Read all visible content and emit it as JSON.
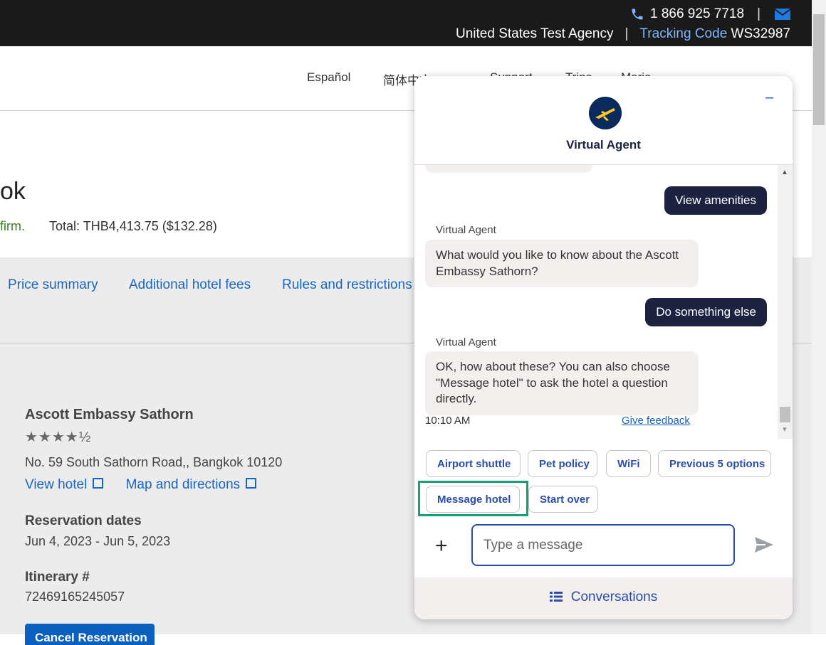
{
  "header": {
    "phone": "1 866 925 7718",
    "separator": "|",
    "agency": "United States Test Agency",
    "tracking_label": "Tracking Code",
    "tracking_code": "WS32987"
  },
  "nav": {
    "lang_es": "Español",
    "lang_zh": "简体中文",
    "support": "Support",
    "trips": "Trips",
    "user": "Maria"
  },
  "hotel_header": {
    "title_fragment": "ok",
    "confirm_fragment": "firm.",
    "total": "Total: THB4,413.75 ($132.28)"
  },
  "tabs": [
    "Price summary",
    "Additional hotel fees",
    "Rules and restrictions"
  ],
  "hotel": {
    "name": "Ascott Embassy Sathorn",
    "stars": "★★★★½",
    "address": "No. 59 South Sathorn Road,, Bangkok 10120",
    "view_hotel": "View hotel",
    "map": "Map and directions",
    "res_dates_label": "Reservation dates",
    "res_dates": "Jun 4, 2023 - Jun 5, 2023",
    "itinerary_label": "Itinerary #",
    "itinerary": "72469165245057",
    "cancel_button": "Cancel Reservation"
  },
  "chat": {
    "title": "Virtual Agent",
    "minimize": "−",
    "messages": {
      "user_1": "View amenities",
      "agent_label_1": "Virtual Agent",
      "agent_1": "What would you like to know about the Ascott Embassy Sathorn?",
      "user_2": "Do something else",
      "agent_label_2": "Virtual Agent",
      "agent_2": "OK, how about these? You can also choose \"Message hotel\" to ask the hotel a question directly."
    },
    "time": "10:10 AM",
    "feedback": "Give feedback",
    "quick_replies": [
      "Airport shuttle",
      "Pet policy",
      "WiFi",
      "Previous 5 options",
      "Message hotel",
      "Start over"
    ],
    "input_placeholder": "Type a message",
    "conversations": "Conversations"
  },
  "colors": {
    "accent": "#1a65c0",
    "chat_dark": "#1c2340",
    "highlight": "#13a07a"
  }
}
